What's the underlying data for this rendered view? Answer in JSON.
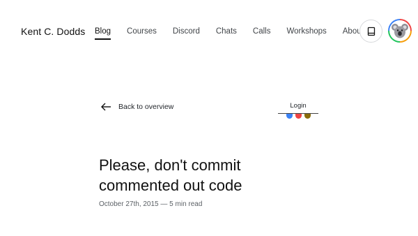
{
  "header": {
    "brand": "Kent C. Dodds",
    "links": [
      {
        "label": "Blog",
        "active": true
      },
      {
        "label": "Courses"
      },
      {
        "label": "Discord"
      },
      {
        "label": "Chats"
      },
      {
        "label": "Calls"
      },
      {
        "label": "Workshops"
      },
      {
        "label": "About"
      }
    ],
    "theme_toggle_icon": "book-icon",
    "avatar_icon": "koala-avatar-icon"
  },
  "page": {
    "back_label": "Back to overview",
    "login_label": "Login",
    "login_dot_colors": [
      "#3b82f6",
      "#ef4444",
      "#8a6d0b"
    ],
    "title": "Please, don't commit commented out code",
    "meta": "October 27th, 2015 — 5 min read"
  }
}
